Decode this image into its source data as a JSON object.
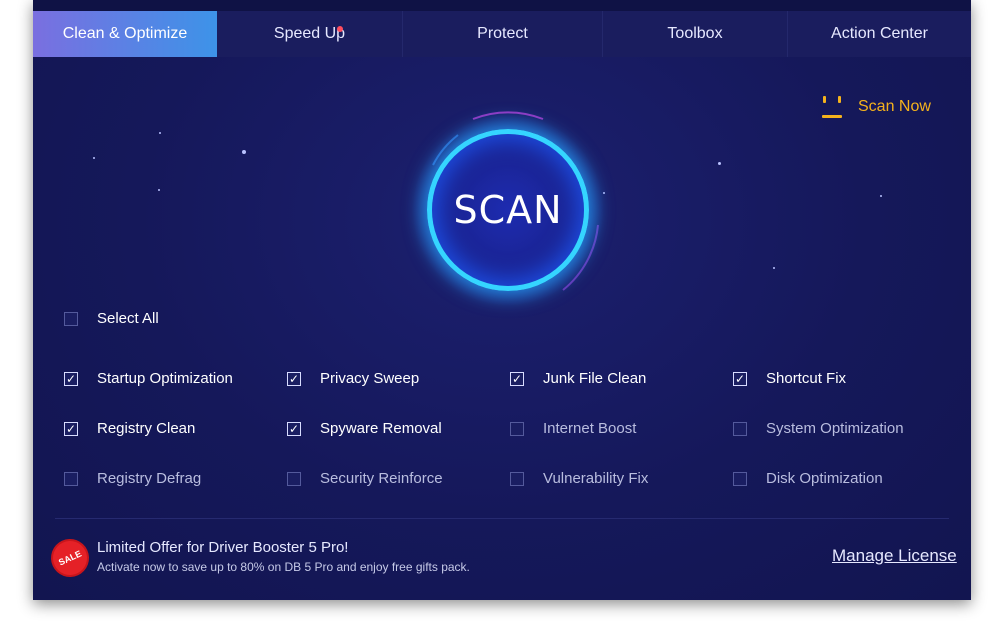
{
  "nav": {
    "tabs": [
      {
        "label": "Clean & Optimize",
        "active": true
      },
      {
        "label": "Speed Up",
        "notification_dot": true
      },
      {
        "label": "Protect"
      },
      {
        "label": "Toolbox"
      },
      {
        "label": "Action Center"
      }
    ]
  },
  "scan": {
    "button_label": "SCAN",
    "scan_now_label": "Scan Now"
  },
  "select_all": {
    "label": "Select All",
    "checked": false
  },
  "options": [
    {
      "label": "Startup Optimization",
      "checked": true
    },
    {
      "label": "Privacy Sweep",
      "checked": true
    },
    {
      "label": "Junk File Clean",
      "checked": true
    },
    {
      "label": "Shortcut Fix",
      "checked": true
    },
    {
      "label": "Registry Clean",
      "checked": true
    },
    {
      "label": "Spyware Removal",
      "checked": true
    },
    {
      "label": "Internet Boost",
      "checked": false
    },
    {
      "label": "System Optimization",
      "checked": false
    },
    {
      "label": "Registry Defrag",
      "checked": false
    },
    {
      "label": "Security Reinforce",
      "checked": false
    },
    {
      "label": "Vulnerability Fix",
      "checked": false
    },
    {
      "label": "Disk Optimization",
      "checked": false
    }
  ],
  "promo": {
    "badge": "SALE",
    "title": "Limited Offer for Driver Booster 5 Pro!",
    "subtitle": "Activate now to save up to 80% on DB 5 Pro and enjoy free gifts pack."
  },
  "footer": {
    "manage_license": "Manage License"
  },
  "colors": {
    "accent": "#3d93e8",
    "scan_now": "#f4b21d",
    "sale": "#e52127",
    "background": "#15185a"
  }
}
